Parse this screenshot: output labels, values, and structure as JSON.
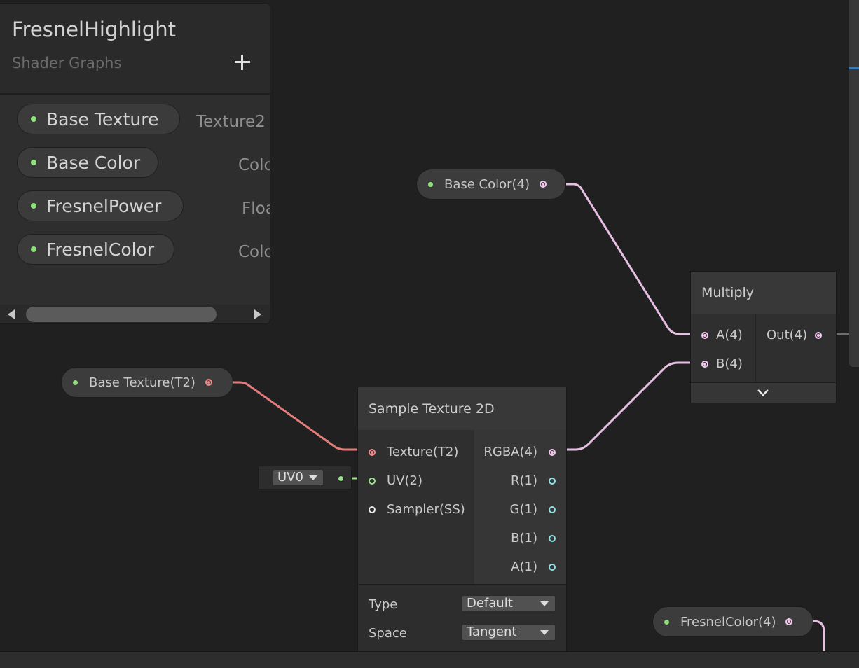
{
  "blackboard": {
    "title": "FresnelHighlight",
    "subtitle": "Shader Graphs",
    "add_icon": "plus-icon",
    "properties": [
      {
        "name": "Base Texture",
        "type": "Texture2"
      },
      {
        "name": "Base Color",
        "type": "Colo"
      },
      {
        "name": "FresnelPower",
        "type": "Floa"
      },
      {
        "name": "FresnelColor",
        "type": "Colo"
      }
    ]
  },
  "nodes": {
    "base_color_property": {
      "label": "Base Color(4)"
    },
    "base_texture_property": {
      "label": "Base Texture(T2)"
    },
    "fresnel_color_property": {
      "label": "FresnelColor(4)"
    },
    "multiply": {
      "title": "Multiply",
      "inputs": [
        "A(4)",
        "B(4)"
      ],
      "output": "Out(4)",
      "expand_icon": "chevron-down-icon"
    },
    "sample_texture": {
      "title": "Sample Texture 2D",
      "inputs": [
        "Texture(T2)",
        "UV(2)",
        "Sampler(SS)"
      ],
      "outputs": [
        "RGBA(4)",
        "R(1)",
        "G(1)",
        "B(1)",
        "A(1)"
      ],
      "type_label": "Type",
      "type_value": "Default",
      "space_label": "Space",
      "space_value": "Tangent"
    },
    "uv_input": {
      "value": "UV0"
    }
  },
  "colors": {
    "background": "#202020",
    "vector4_wire": "#e6bfe3",
    "texture_wire": "#e47c7c",
    "vector2_wire": "#9be28a",
    "property_dot": "#8ee07a"
  }
}
